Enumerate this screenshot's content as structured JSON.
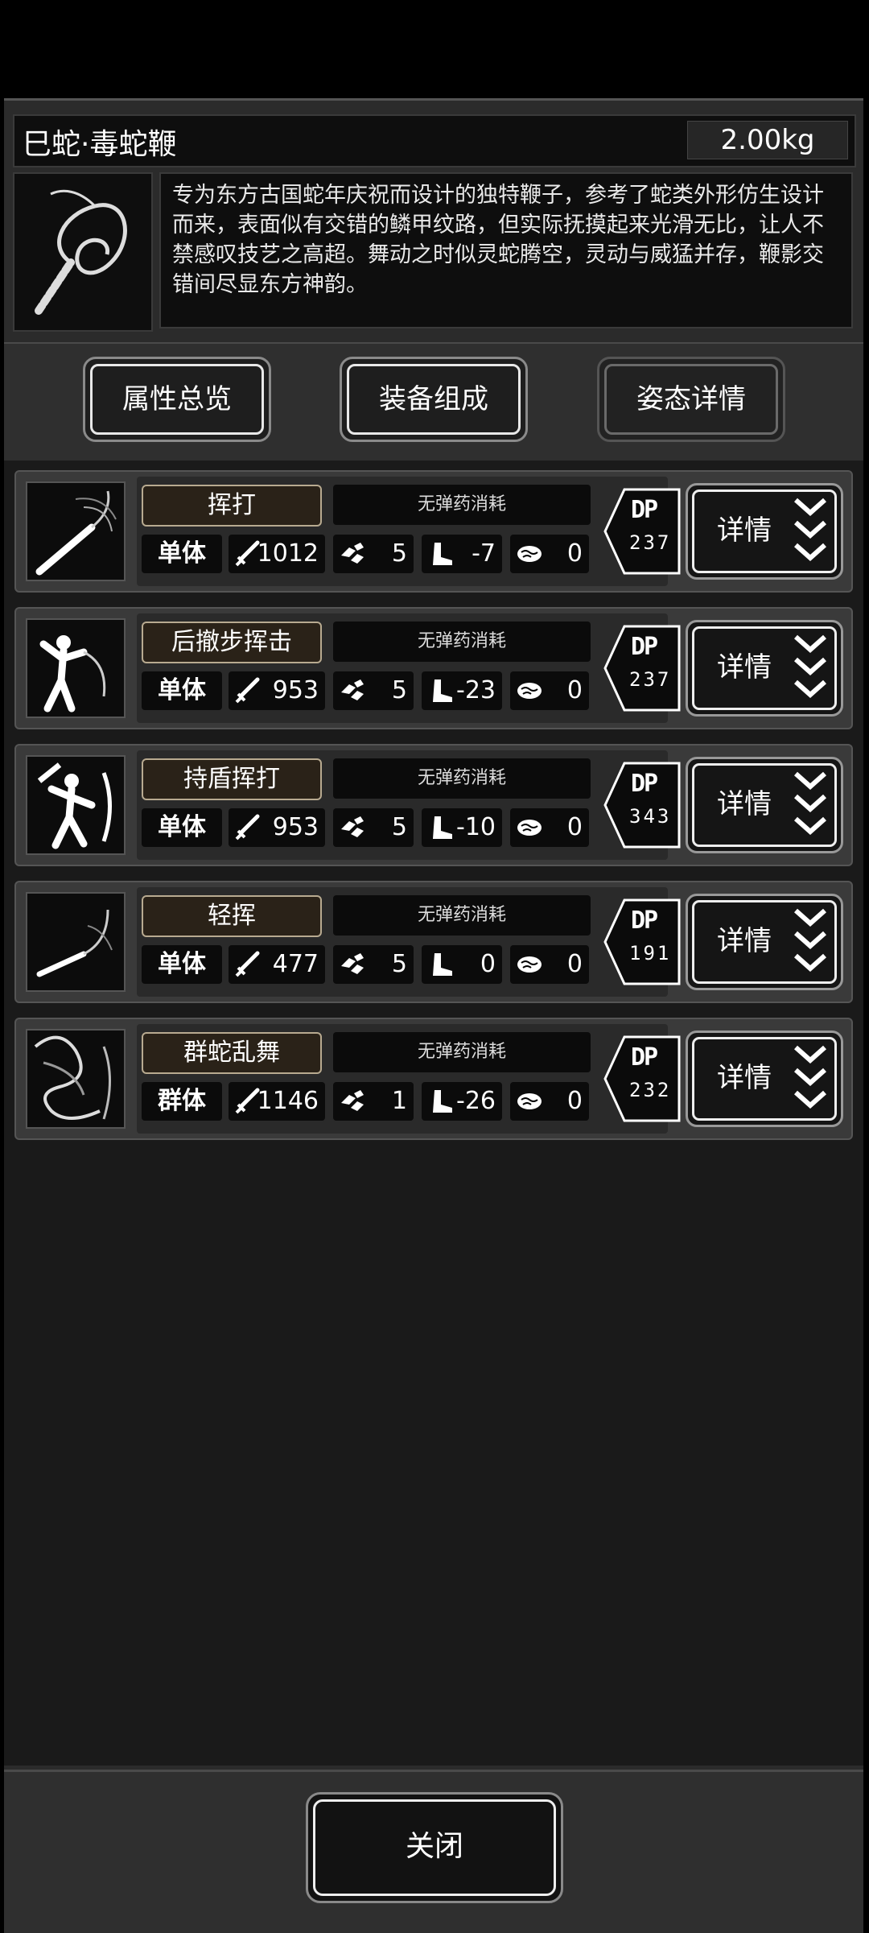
{
  "item": {
    "name": "巳蛇·毒蛇鞭",
    "weight": "2.00kg",
    "description": "专为东方古国蛇年庆祝而设计的独特鞭子，参考了蛇类外形仿生设计而来，表面似有交错的鳞甲纹路，但实际抚摸起来光滑无比，让人不禁感叹技艺之高超。舞动之时似灵蛇腾空，灵动与威猛并存，鞭影交错间尽显东方神韵。"
  },
  "tabs": [
    {
      "label": "属性总览",
      "active": false
    },
    {
      "label": "装备组成",
      "active": false
    },
    {
      "label": "姿态详情",
      "active": true
    }
  ],
  "stance_labels": {
    "dp": "DP",
    "detail": "详情"
  },
  "stances": [
    {
      "name": "挥打",
      "ammo": "无弹药消耗",
      "target": "单体",
      "attack": "1012",
      "speed": "5",
      "move": "-7",
      "brain": "0",
      "dp": "237",
      "icon": "whip-swing-icon"
    },
    {
      "name": "后撤步挥击",
      "ammo": "无弹药消耗",
      "target": "单体",
      "attack": "953",
      "speed": "5",
      "move": "-23",
      "brain": "0",
      "dp": "237",
      "icon": "backstep-swing-icon"
    },
    {
      "name": "持盾挥打",
      "ammo": "无弹药消耗",
      "target": "单体",
      "attack": "953",
      "speed": "5",
      "move": "-10",
      "brain": "0",
      "dp": "343",
      "icon": "shield-swing-icon"
    },
    {
      "name": "轻挥",
      "ammo": "无弹药消耗",
      "target": "单体",
      "attack": "477",
      "speed": "5",
      "move": "0",
      "brain": "0",
      "dp": "191",
      "icon": "light-swing-icon"
    },
    {
      "name": "群蛇乱舞",
      "ammo": "无弹药消耗",
      "target": "群体",
      "attack": "1146",
      "speed": "1",
      "move": "-26",
      "brain": "0",
      "dp": "232",
      "icon": "snake-dance-icon"
    }
  ],
  "footer": {
    "close": "关闭"
  }
}
